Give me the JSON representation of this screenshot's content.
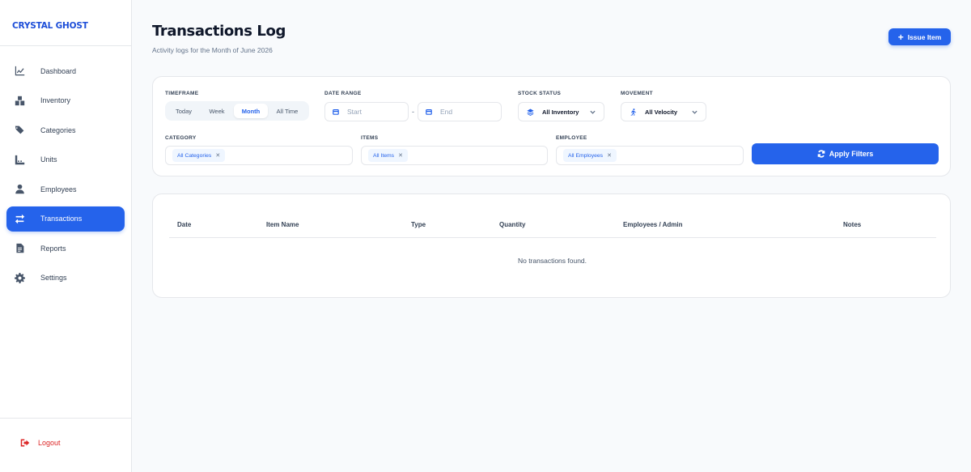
{
  "brand": "CRYSTAL GHOST",
  "sidebar": {
    "items": [
      {
        "label": "Dashboard",
        "icon": "chart-line-icon"
      },
      {
        "label": "Inventory",
        "icon": "boxes-icon"
      },
      {
        "label": "Categories",
        "icon": "tags-icon"
      },
      {
        "label": "Units",
        "icon": "ruler-icon"
      },
      {
        "label": "Employees",
        "icon": "user-icon"
      },
      {
        "label": "Transactions",
        "icon": "arrows-exchange-icon",
        "active": true
      },
      {
        "label": "Reports",
        "icon": "file-icon"
      },
      {
        "label": "Settings",
        "icon": "gear-icon"
      }
    ],
    "logout": "Logout"
  },
  "header": {
    "title": "Transactions Log",
    "subtitle": "Activity logs for the Month of June 2026",
    "issue_button": "Issue Item"
  },
  "filters": {
    "timeframe": {
      "label": "TIMEFRAME",
      "options": [
        "Today",
        "Week",
        "Month",
        "All Time"
      ],
      "selected": "Month"
    },
    "date_range": {
      "label": "DATE RANGE",
      "start_placeholder": "Start",
      "separator": "-",
      "end_placeholder": "End"
    },
    "stock_status": {
      "label": "STOCK STATUS",
      "value": "All Inventory"
    },
    "movement": {
      "label": "MOVEMENT",
      "value": "All Velocity"
    },
    "category": {
      "label": "CATEGORY",
      "tag": "All Categories"
    },
    "items": {
      "label": "ITEMS",
      "tag": "All Items"
    },
    "employee": {
      "label": "EMPLOYEE",
      "tag": "All Employees"
    },
    "apply_button": "Apply Filters"
  },
  "table": {
    "columns": [
      "Date",
      "Item Name",
      "Type",
      "Quantity",
      "Employees / Admin",
      "Notes"
    ],
    "empty_message": "No transactions found."
  },
  "colors": {
    "accent": "#2563eb",
    "danger": "#dc2626",
    "background": "#f8fafc"
  }
}
